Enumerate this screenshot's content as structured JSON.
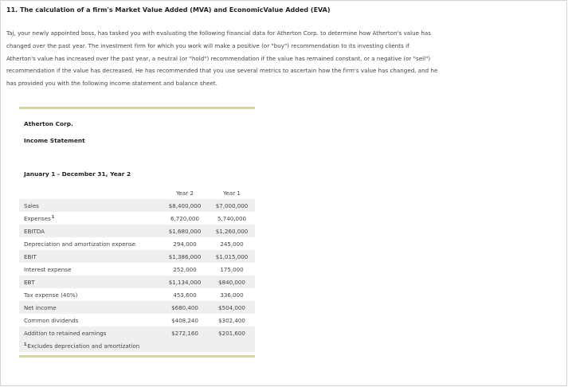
{
  "question": {
    "title": "11. The calculation of a firm's Market Value Added (MVA) and EconomicValue Added (EVA)",
    "intro_lines": [
      "Taj, your newly appointed boss, has tasked you with evaluating the following financial data for Atherton Corp. to determine how Atherton's value has",
      "changed over the past year. The investment firm for which you work will make a positive (or \"buy\") recommendation to its investing clients if",
      "Atherton's value has increased over the past year, a neutral (or \"hold\") recommendation if the value has remained constant, or a negative (or \"sell\")",
      "recommendation if the value has decreased. He has recommended that you use several metrics to ascertain how the firm's value has changed, and he",
      "has provided you with the following income statement and balance sheet."
    ]
  },
  "statement": {
    "company": "Atherton Corp.",
    "name": "Income Statement",
    "period": "January 1 - December 31, Year 2",
    "columns": [
      "Year 2",
      "Year 1"
    ],
    "rows": [
      {
        "label": "Sales",
        "footnote_mark": "",
        "y2": "$8,400,000",
        "y1": "$7,000,000"
      },
      {
        "label": "Expenses",
        "footnote_mark": "1",
        "y2": "6,720,000",
        "y1": "5,740,000"
      },
      {
        "label": "EBITDA",
        "footnote_mark": "",
        "y2": "$1,680,000",
        "y1": "$1,260,000"
      },
      {
        "label": "Depreciation and amortization expense",
        "footnote_mark": "",
        "y2": "294,000",
        "y1": "245,000"
      },
      {
        "label": "EBIT",
        "footnote_mark": "",
        "y2": "$1,386,000",
        "y1": "$1,015,000"
      },
      {
        "label": "Interest expense",
        "footnote_mark": "",
        "y2": "252,000",
        "y1": "175,000"
      },
      {
        "label": "EBT",
        "footnote_mark": "",
        "y2": "$1,134,000",
        "y1": "$840,000"
      },
      {
        "label": "Tax expense (40%)",
        "footnote_mark": "",
        "y2": "453,600",
        "y1": "336,000"
      },
      {
        "label": "Net income",
        "footnote_mark": "",
        "y2": "$680,400",
        "y1": "$504,000"
      },
      {
        "label": "Common dividends",
        "footnote_mark": "",
        "y2": "$408,240",
        "y1": "$302,400"
      },
      {
        "label": "Addition to retained earnings",
        "footnote_mark": "",
        "y2": "$272,160",
        "y1": "$201,600"
      }
    ],
    "footnote": {
      "mark": "1",
      "text": "Excludes depreciation and amortization"
    }
  },
  "colors": {
    "rule": "#d8d2a6",
    "row_shade": "#efefef"
  }
}
